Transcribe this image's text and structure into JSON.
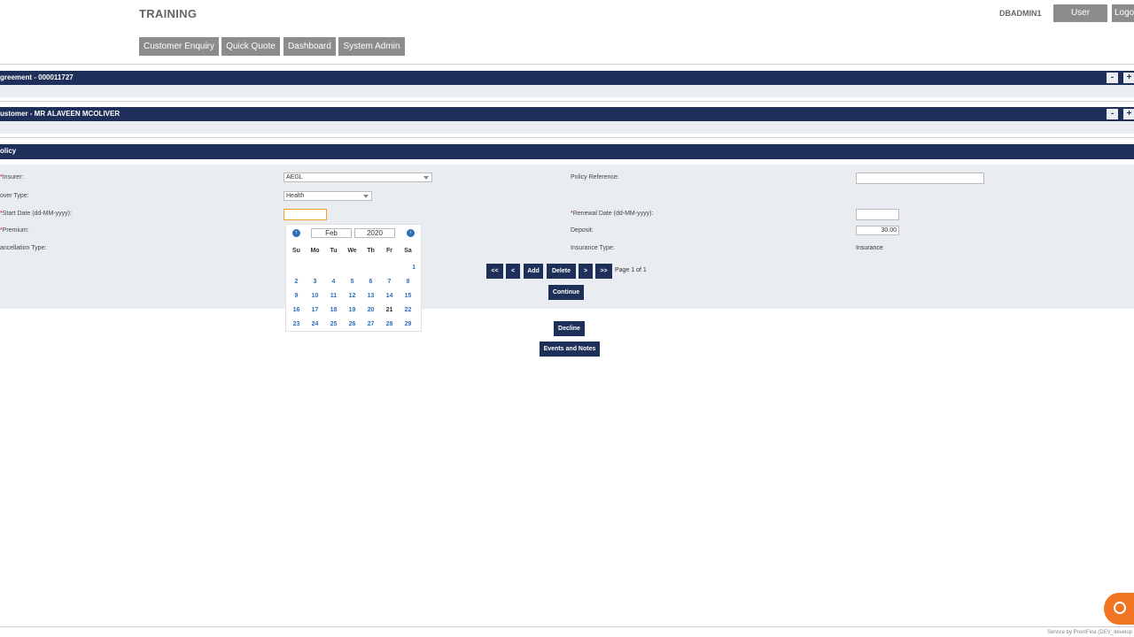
{
  "header": {
    "app_title": "TRAINING",
    "username": "DBADMIN1",
    "user_guide": "User Guide",
    "logout": "Logo"
  },
  "nav": {
    "customer_enquiry": "Customer Enquiry",
    "quick_quote": "Quick Quote",
    "dashboard": "Dashboard",
    "system_admin": "System Admin"
  },
  "sections": {
    "agreement": "greement - 000011727",
    "customer": "ustomer - MR ALAVEEN MCOLIVER",
    "policy": "olicy",
    "minus": "-",
    "plus": "+"
  },
  "form": {
    "insurer_label": "Insurer:",
    "insurer_value": "AEGL",
    "cover_type_label": "over Type:",
    "cover_type_value": "Health",
    "start_date_label": "Start Date (dd-MM-yyyy):",
    "start_date_value": "",
    "premium_label": "Premium:",
    "cancellation_type_label": "ancellation Type:",
    "policy_reference_label": "Policy Reference:",
    "policy_reference_value": "",
    "renewal_date_label": "Renewal Date (dd-MM-yyyy):",
    "renewal_date_value": "",
    "deposit_label": "Deposit:",
    "deposit_value": "30.00",
    "insurance_type_label": "Insurance Type:",
    "insurance_type_value": "Insurance",
    "required_mark": "*"
  },
  "pager": {
    "first": "<<",
    "prev": "<",
    "add": "Add",
    "delete": "Delete",
    "next": ">",
    "last": ">>",
    "page_info": "Page 1 of 1"
  },
  "actions": {
    "continue": "Continue",
    "decline": "Decline",
    "events_notes": "Events and Notes"
  },
  "calendar": {
    "month": "Feb",
    "year": "2020",
    "prev_icon": "‹",
    "next_icon": "›",
    "weekdays": [
      "Su",
      "Mo",
      "Tu",
      "We",
      "Th",
      "Fr",
      "Sa"
    ],
    "weeks": [
      [
        "",
        "",
        "",
        "",
        "",
        "",
        "1"
      ],
      [
        "2",
        "3",
        "4",
        "5",
        "6",
        "7",
        "8"
      ],
      [
        "9",
        "10",
        "11",
        "12",
        "13",
        "14",
        "15"
      ],
      [
        "16",
        "17",
        "18",
        "19",
        "20",
        "21",
        "22"
      ],
      [
        "23",
        "24",
        "25",
        "26",
        "27",
        "28",
        "29"
      ]
    ],
    "today": "21"
  },
  "footer": {
    "text": "Service by PremFina (DEV_develop"
  },
  "colors": {
    "navy": "#1e2f5a",
    "gray_button": "#8c8c8c",
    "link_blue": "#2f6fb7",
    "chat_orange": "#f07522"
  }
}
